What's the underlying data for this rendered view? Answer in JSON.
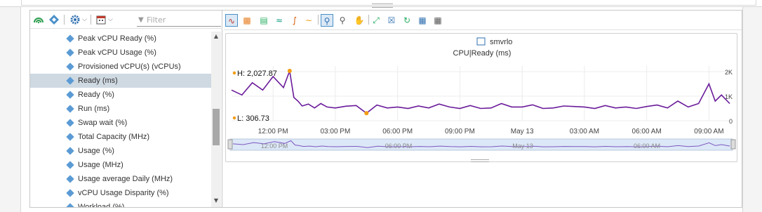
{
  "left_toolbar": {
    "icons": [
      "health-icon",
      "relationship-icon",
      "settings-icon",
      "calendar-icon"
    ],
    "filter_placeholder": "Filter"
  },
  "tree": {
    "items": [
      {
        "label": "Peak vCPU Ready (%)",
        "selected": false
      },
      {
        "label": "Peak vCPU Usage (%)",
        "selected": false
      },
      {
        "label": "Provisioned vCPU(s) (vCPUs)",
        "selected": false
      },
      {
        "label": "Ready (ms)",
        "selected": true
      },
      {
        "label": "Ready (%)",
        "selected": false
      },
      {
        "label": "Run (ms)",
        "selected": false
      },
      {
        "label": "Swap wait (%)",
        "selected": false
      },
      {
        "label": "Total Capacity (MHz)",
        "selected": false
      },
      {
        "label": "Usage (%)",
        "selected": false
      },
      {
        "label": "Usage (MHz)",
        "selected": false
      },
      {
        "label": "Usage average Daily (MHz)",
        "selected": false
      },
      {
        "label": "vCPU Usage Disparity (%)",
        "selected": false
      },
      {
        "label": "Workload (%)",
        "selected": false
      }
    ]
  },
  "right_toolbar": {
    "icons": [
      "line-chart-icon",
      "bar-chart-icon",
      "trend-icon",
      "dynamic-threshold-icon",
      "anomaly-icon",
      "forecast-icon",
      "zoom-select-icon",
      "zoom-out-icon",
      "pan-icon",
      "fit-all-icon",
      "close-chart-icon",
      "refresh-icon",
      "date-icon",
      "calendar-range-icon"
    ]
  },
  "chart": {
    "object_name": "smvrlo",
    "metric_title": "CPU|Ready (ms)",
    "high_label": "H: 2,027.87",
    "low_label": "L: 306.73",
    "line_color": "#6a1b9a",
    "marker_color": "#f39c12",
    "nav_line_color": "#7e57c2",
    "nav_fill_color": "#dce8f7"
  },
  "chart_data": {
    "type": "line",
    "title": "CPU|Ready (ms)",
    "xlabel": "",
    "ylabel": "",
    "x_ticks": [
      "12:00 PM",
      "03:00 PM",
      "06:00 PM",
      "09:00 PM",
      "May 13",
      "03:00 AM",
      "06:00 AM",
      "09:00 AM"
    ],
    "y_ticks": [
      "2K",
      "1K",
      "0"
    ],
    "ylim": [
      0,
      2000
    ],
    "high": 2027.87,
    "low": 306.73,
    "nav_ticks": [
      "12:00 PM",
      "06:00 PM",
      "May 13",
      "06:00 AM"
    ],
    "series": [
      {
        "x": [
          0,
          0.5,
          1,
          1.5,
          2,
          2.5,
          2.8,
          3,
          3.2,
          3.4,
          3.7,
          4,
          4.3,
          4.6,
          5,
          5.5,
          6,
          6.5,
          7,
          7.5,
          8,
          8.5,
          9,
          9.5,
          10,
          10.5,
          11,
          11.5,
          12,
          12.5,
          13,
          13.5,
          14,
          14.5,
          15,
          15.5,
          16,
          16.5,
          17,
          17.5,
          18,
          18.5,
          19,
          19.5,
          20,
          20.5,
          21,
          21.5,
          22,
          22.5,
          23,
          23.3,
          23.6,
          24
        ],
        "values": [
          1250,
          1050,
          1550,
          1250,
          1800,
          1350,
          2028,
          950,
          800,
          600,
          680,
          520,
          700,
          560,
          520,
          590,
          620,
          307,
          640,
          520,
          560,
          500,
          600,
          520,
          680,
          560,
          500,
          620,
          500,
          520,
          700,
          560,
          560,
          650,
          500,
          520,
          600,
          580,
          560,
          500,
          620,
          520,
          560,
          500,
          580,
          640,
          520,
          800,
          560,
          700,
          1500,
          800,
          1050,
          700
        ]
      }
    ]
  }
}
